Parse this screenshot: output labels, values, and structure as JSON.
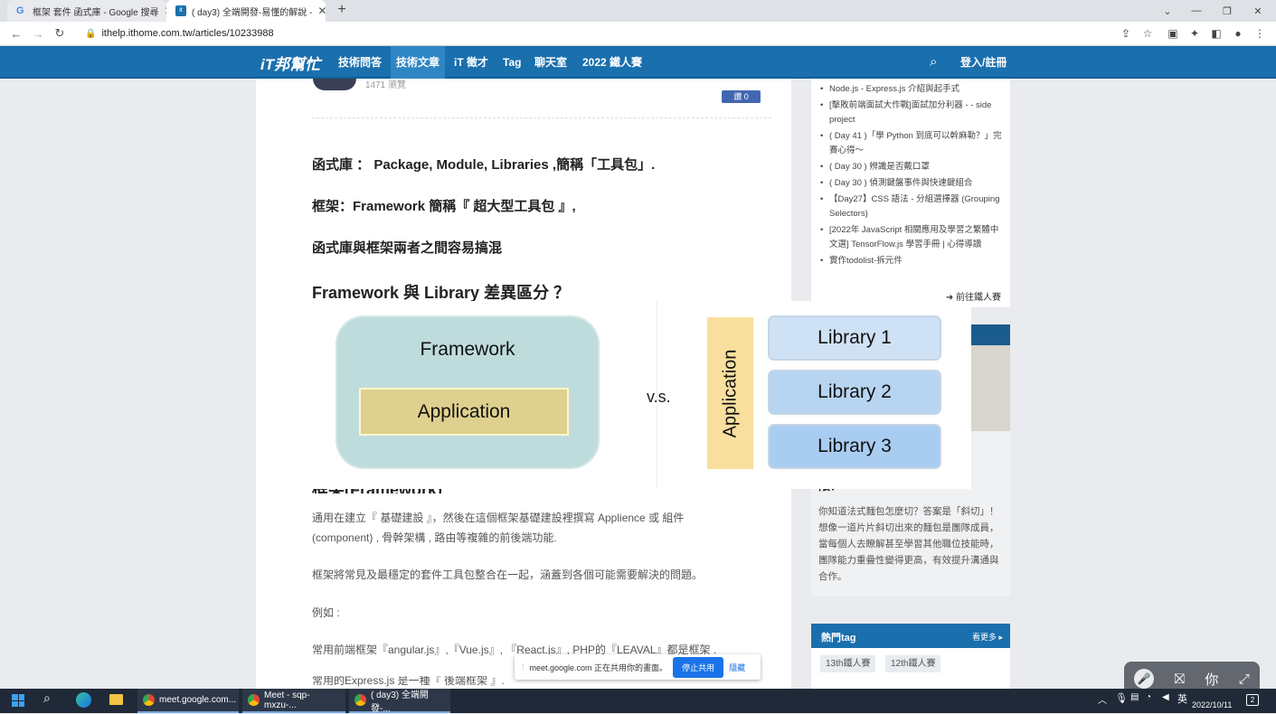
{
  "browser": {
    "tabs": [
      {
        "title": "框架 套件 函式庫 - Google 搜尋",
        "favicon": "G"
      },
      {
        "title": "( day3) 全端開發-易懂的解說 -",
        "favicon": "it"
      }
    ],
    "new_tab": "+",
    "url": "ithelp.ithome.com.tw/articles/10233988"
  },
  "site_nav": {
    "logo": "iT邦幫忙",
    "items": [
      "技術問答",
      "技術文章",
      "iT 徵才",
      "Tag",
      "聊天室",
      "2022 鐵人賽"
    ],
    "active_item": "技術文章",
    "login": "登入/註冊"
  },
  "article": {
    "views": "1471 瀏覽",
    "like_badge": "讚 0",
    "h1": "函式庫 ： Package, Module, Libraries ,簡稱「工具包」.",
    "h2": "框架：Framework 簡稱『 超大型工具包 』,",
    "h3": "函式庫與框架兩者之間容易搞混",
    "h4": "Framework 與 Library 差異區分 ？",
    "section_title": "框架(Framework)",
    "p1": "通用在建立『 基礎建設 』，然後在這個框架基礎建設裡撰寫 Applience 或 組件",
    "p1b": "(component) , 骨幹架構 , 路由等複雜的前後端功能.",
    "p2": "框架將常見及最穩定的套件工具包整合在一起，涵蓋到各個可能需要解決的問題。",
    "p3": "例如 :",
    "p4": "常用前端框架『angular.js』,『Vue.js』, 『React.js』, PHP的『LEAVAL』都是框架 .",
    "p5": "常用的Express.js 是一種『 後端框架 』."
  },
  "diagram": {
    "framework_label": "Framework",
    "application_label": "Application",
    "vs": "v.s.",
    "vertical_app": "Application",
    "libraries": [
      "Library 1",
      "Library 2",
      "Library 3"
    ]
  },
  "sidebar": {
    "links": [
      "Node.js - Express.js 介紹與起手式",
      "[擊敗前端面試大作戰]面試加分利器 - - side project",
      "( Day 41 )「學 Python 到底可以幹麻勒？」完賽心得～",
      "( Day 30 ) 辨識是否戴口罩",
      "( Day 30 ) 偵測鍵盤事件與快速鍵組合",
      "【Day27】CSS 語法 - 分組選擇器 (Grouping Selectors)",
      "[2022年 JavaScript 相關應用及學習之繁體中文選] TensorFlow.js 學習手冊 | 心得導讀",
      "實作todolist-拆元件"
    ],
    "more_ironman": "前往鐵人賽",
    "card_title_tail": "限？",
    "card_text": "你知道法式麵包怎麼切？答案是「斜切」！想像一道片片斜切出來的麵包是團隊成員，當每個人去瞭解甚至學習其他職位技能時，團隊能力重疊性變得更高，有效提升溝通與合作。",
    "hot_tags_title": "熱門tag",
    "see_more": "看更多",
    "tags": [
      "13th鐵人賽",
      "12th鐵人賽"
    ]
  },
  "meet_banner": {
    "text": "meet.google.com 正在共用你的畫面。",
    "stop": "停止共用",
    "hide": "隱藏"
  },
  "meet_controls": {
    "you": "你"
  },
  "taskbar": {
    "apps": [
      "meet.google.com...",
      "Meet - sqp-mxzu-...",
      "( day3) 全端開發-..."
    ],
    "ime": "英",
    "date": "2022/10/11",
    "notif": "2"
  }
}
